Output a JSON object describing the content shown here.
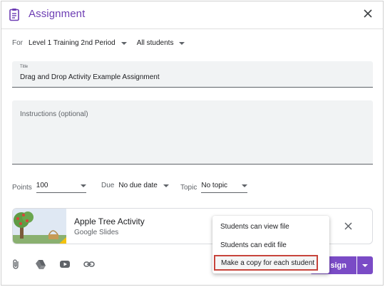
{
  "header": {
    "title": "Assignment",
    "icon": "assignment-clipboard-icon",
    "accent": "#6d3db3"
  },
  "for_row": {
    "label": "For",
    "class_value": "Level 1 Training 2nd Period",
    "students_value": "All students"
  },
  "title_field": {
    "label": "Title",
    "value": "Drag and Drop Activity Example Assignment"
  },
  "instructions_field": {
    "placeholder": "Instructions (optional)"
  },
  "meta": {
    "points_label": "Points",
    "points_value": "100",
    "due_label": "Due",
    "due_value": "No due date",
    "topic_label": "Topic",
    "topic_value": "No topic"
  },
  "attachment": {
    "title": "Apple Tree Activity",
    "subtitle": "Google Slides"
  },
  "share_menu": {
    "items": [
      "Students can view file",
      "Students can edit file",
      "Make a copy for each student"
    ],
    "highlight_color": "#c7443b"
  },
  "assign_button": {
    "label": "Assign",
    "visible_label": "sign",
    "color": "#7a4bc6"
  },
  "bottom_icons": [
    "paperclip-icon",
    "google-drive-icon",
    "youtube-icon",
    "link-icon"
  ]
}
